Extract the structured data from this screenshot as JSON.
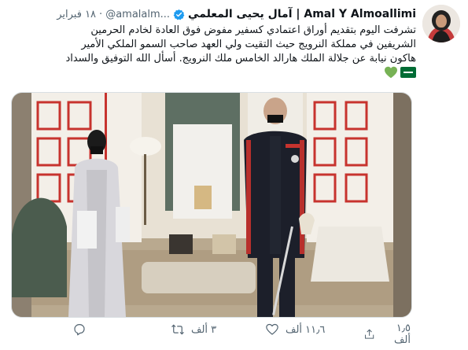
{
  "user": {
    "display_name": "Amal Y Almoallimi | آمال يحيى المعلمي",
    "handle": "@amalalm...",
    "dot": "·",
    "date": "١٨ فبراير"
  },
  "tweet": {
    "lines": [
      "تشرفت اليوم بتقديم أوراق اعتمادي كسفير مفوض فوق العادة لخادم الحرمين",
      "الشريفين في مملكة النرويج حيث التقيت ولي العهد صاحب السمو الملكي الأمير",
      "هاكون نيابة عن جلالة الملك هارالد الخامس ملك النرويج. أسأل الله التوفيق والسداد"
    ],
    "emojis": [
      "flag-saudi-arabia",
      "green-heart"
    ]
  },
  "actions": {
    "reply": {
      "icon": "reply-icon",
      "count": ""
    },
    "retweet": {
      "icon": "retweet-icon",
      "count": "٣ ألف"
    },
    "like": {
      "icon": "heart-icon",
      "count": "١١٫٦ ألف"
    },
    "share": {
      "icon": "share-icon",
      "count": "١٫٥ ألف"
    }
  },
  "colors": {
    "text": "#0f1419",
    "secondary": "#536471",
    "verified": "#1d9bf0",
    "border": "#d9dfe3"
  }
}
